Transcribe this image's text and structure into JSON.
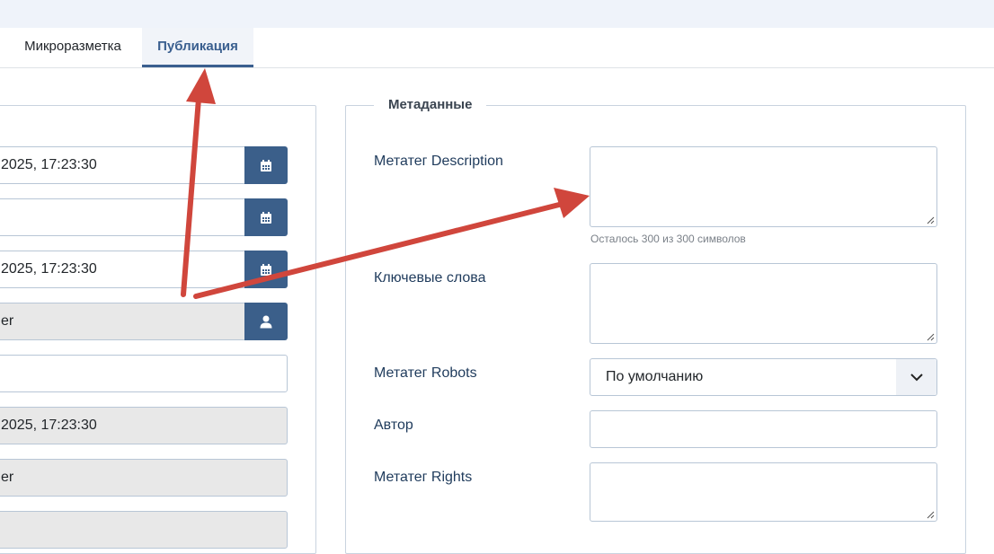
{
  "tabs": [
    {
      "label": "Микроразметка"
    },
    {
      "label": "Публикация"
    }
  ],
  "left_panel": {
    "fields": [
      {
        "value": "2025, 17:23:30",
        "button_icon": "calendar-icon"
      },
      {
        "value": "",
        "button_icon": "calendar-icon"
      },
      {
        "value": "2025, 17:23:30",
        "button_icon": "calendar-icon"
      },
      {
        "value": "er",
        "button_icon": "user-icon"
      },
      {
        "value": ""
      },
      {
        "value": "2025, 17:23:30"
      },
      {
        "value": "er"
      },
      {
        "value": ""
      }
    ]
  },
  "metadata": {
    "legend": "Метаданные",
    "description_label": "Метатег Description",
    "description_value": "",
    "description_hint": "Осталось 300 из 300 символов",
    "keywords_label": "Ключевые слова",
    "keywords_value": "",
    "robots_label": "Метатег Robots",
    "robots_value": "По умолчанию",
    "author_label": "Автор",
    "author_value": "",
    "rights_label": "Метатег Rights",
    "rights_value": ""
  },
  "colors": {
    "accent": "#3b5f8a",
    "annotation_arrow": "#d0463c",
    "active_tab_text": "#3a5f8f"
  }
}
